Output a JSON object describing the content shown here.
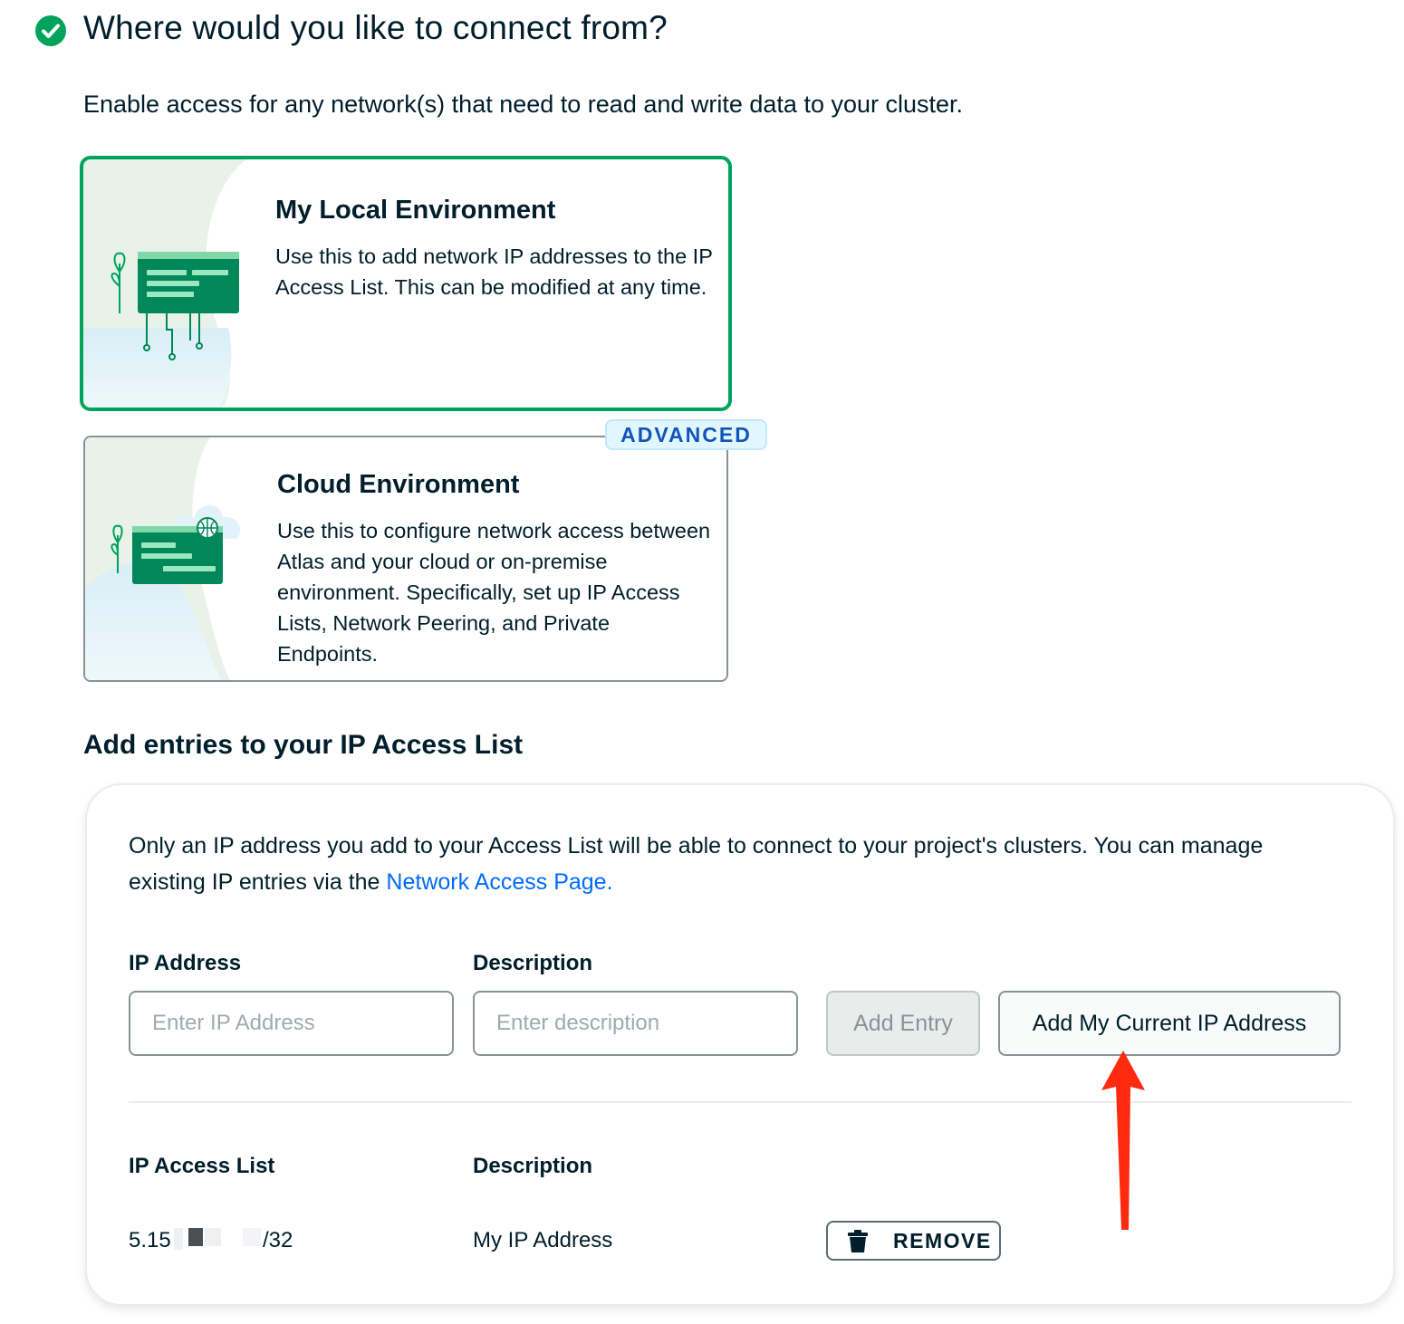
{
  "header": {
    "title": "Where would you like to connect from?",
    "subtitle": "Enable access for any network(s) that need to read and write data to your cluster."
  },
  "environments": {
    "local": {
      "title": "My Local Environment",
      "description": "Use this to add network IP addresses to the IP Access List. This can be modified at any time.",
      "selected": true
    },
    "cloud": {
      "title": "Cloud Environment",
      "description": "Use this to configure network access between Atlas and your cloud or on-premise environment. Specifically, set up IP Access Lists, Network Peering, and Private Endpoints.",
      "badge": "ADVANCED",
      "selected": false
    }
  },
  "access_list": {
    "section_title": "Add entries to your IP Access List",
    "info_text": "Only an IP address you add to your Access List will be able to connect to your project's clusters. You can manage existing IP entries via the ",
    "info_link": "Network Access Page.",
    "form": {
      "ip_label": "IP Address",
      "ip_placeholder": "Enter IP Address",
      "description_label": "Description",
      "description_placeholder": "Enter description",
      "add_entry_label": "Add Entry",
      "add_current_ip_label": "Add My Current IP Address"
    },
    "table": {
      "col_ip": "IP Access List",
      "col_description": "Description",
      "rows": [
        {
          "ip_prefix": "5.15",
          "ip_suffix": "/32",
          "description": "My IP Address",
          "action_label": "REMOVE"
        }
      ]
    }
  },
  "colors": {
    "accent_green": "#00a35c",
    "link_blue": "#016bf8",
    "annotation_red": "#ff2a10",
    "badge_blue": "#1254b7"
  }
}
